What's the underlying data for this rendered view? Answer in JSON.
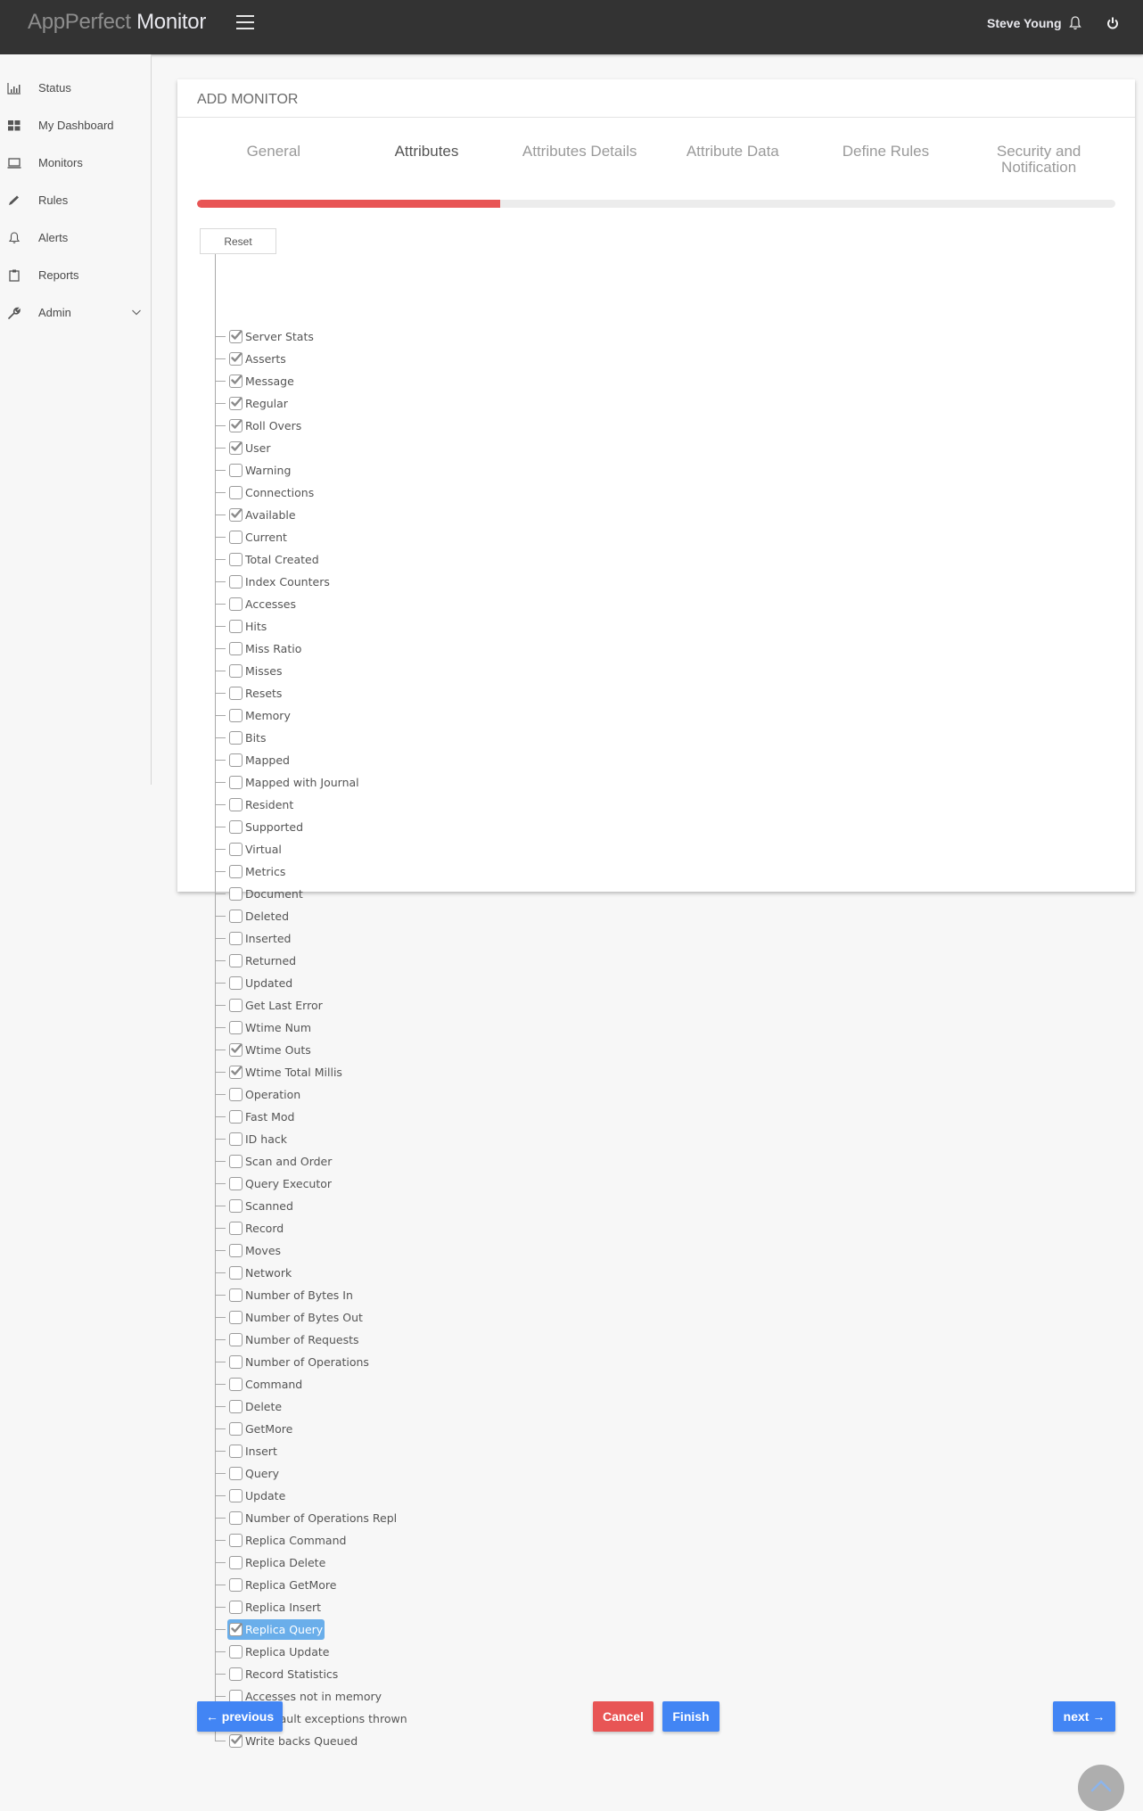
{
  "header": {
    "brand_light": "AppPerfect ",
    "brand_strong": "Monitor",
    "user_name": "Steve Young",
    "icons": {
      "menu": "hamburger-icon",
      "notifications": "bell-icon",
      "logout": "power-icon"
    }
  },
  "sidebar": {
    "items": [
      {
        "label": "Status",
        "icon": "bar-chart-icon"
      },
      {
        "label": "My Dashboard",
        "icon": "dashboard-grid-icon"
      },
      {
        "label": "Monitors",
        "icon": "laptop-icon"
      },
      {
        "label": "Rules",
        "icon": "pencil-icon"
      },
      {
        "label": "Alerts",
        "icon": "bell-icon"
      },
      {
        "label": "Reports",
        "icon": "clipboard-icon"
      },
      {
        "label": "Admin",
        "icon": "wrench-icon",
        "expandable": true
      }
    ]
  },
  "card": {
    "title": "ADD MONITOR",
    "wizard": {
      "tabs": [
        {
          "label": "General",
          "active": false
        },
        {
          "label": "Attributes",
          "active": true
        },
        {
          "label": "Attributes Details",
          "active": false
        },
        {
          "label": "Attribute Data",
          "active": false
        },
        {
          "label": "Define Rules",
          "active": false
        },
        {
          "label": "Security and Notification",
          "active": false
        }
      ],
      "progress_percent": 33,
      "progress_color": "#e85555"
    },
    "reset_label": "Reset",
    "attributes": [
      {
        "label": "Server Stats",
        "checked": true
      },
      {
        "label": "Asserts",
        "checked": true
      },
      {
        "label": "Message",
        "checked": true
      },
      {
        "label": "Regular",
        "checked": true
      },
      {
        "label": "Roll Overs",
        "checked": true
      },
      {
        "label": "User",
        "checked": true
      },
      {
        "label": "Warning",
        "checked": false
      },
      {
        "label": "Connections",
        "checked": false
      },
      {
        "label": "Available",
        "checked": true
      },
      {
        "label": "Current",
        "checked": false
      },
      {
        "label": "Total Created",
        "checked": false
      },
      {
        "label": "Index Counters",
        "checked": false
      },
      {
        "label": "Accesses",
        "checked": false
      },
      {
        "label": "Hits",
        "checked": false
      },
      {
        "label": "Miss Ratio",
        "checked": false
      },
      {
        "label": "Misses",
        "checked": false
      },
      {
        "label": "Resets",
        "checked": false
      },
      {
        "label": "Memory",
        "checked": false
      },
      {
        "label": "Bits",
        "checked": false
      },
      {
        "label": "Mapped",
        "checked": false
      },
      {
        "label": "Mapped with Journal",
        "checked": false
      },
      {
        "label": "Resident",
        "checked": false
      },
      {
        "label": "Supported",
        "checked": false
      },
      {
        "label": "Virtual",
        "checked": false
      },
      {
        "label": "Metrics",
        "checked": false
      },
      {
        "label": "Document",
        "checked": false
      },
      {
        "label": "Deleted",
        "checked": false
      },
      {
        "label": "Inserted",
        "checked": false
      },
      {
        "label": "Returned",
        "checked": false
      },
      {
        "label": "Updated",
        "checked": false
      },
      {
        "label": "Get Last Error",
        "checked": false
      },
      {
        "label": "Wtime Num",
        "checked": false
      },
      {
        "label": "Wtime Outs",
        "checked": true
      },
      {
        "label": "Wtime Total Millis",
        "checked": true
      },
      {
        "label": "Operation",
        "checked": false
      },
      {
        "label": "Fast Mod",
        "checked": false
      },
      {
        "label": "ID hack",
        "checked": false
      },
      {
        "label": "Scan and Order",
        "checked": false
      },
      {
        "label": "Query Executor",
        "checked": false
      },
      {
        "label": "Scanned",
        "checked": false
      },
      {
        "label": "Record",
        "checked": false
      },
      {
        "label": "Moves",
        "checked": false
      },
      {
        "label": "Network",
        "checked": false
      },
      {
        "label": "Number of Bytes In",
        "checked": false
      },
      {
        "label": "Number of Bytes Out",
        "checked": false
      },
      {
        "label": "Number of Requests",
        "checked": false
      },
      {
        "label": "Number of Operations",
        "checked": false
      },
      {
        "label": "Command",
        "checked": false
      },
      {
        "label": "Delete",
        "checked": false
      },
      {
        "label": "GetMore",
        "checked": false
      },
      {
        "label": "Insert",
        "checked": false
      },
      {
        "label": "Query",
        "checked": false
      },
      {
        "label": "Update",
        "checked": false
      },
      {
        "label": "Number of Operations Repl",
        "checked": false
      },
      {
        "label": "Replica Command",
        "checked": false
      },
      {
        "label": "Replica Delete",
        "checked": false
      },
      {
        "label": "Replica GetMore",
        "checked": false
      },
      {
        "label": "Replica Insert",
        "checked": false
      },
      {
        "label": "Replica Query",
        "checked": true,
        "selected": true
      },
      {
        "label": "Replica Update",
        "checked": false
      },
      {
        "label": "Record Statistics",
        "checked": false
      },
      {
        "label": "Accesses not in memory",
        "checked": false
      },
      {
        "label": "Page fault exceptions thrown",
        "checked": true
      },
      {
        "label": "Write backs Queued",
        "checked": true
      }
    ],
    "buttons": {
      "previous": "← previous",
      "cancel": "Cancel",
      "finish": "Finish",
      "next": "next →"
    }
  },
  "colors": {
    "header_bg": "#333333",
    "primary": "#4285f4",
    "danger": "#e85555",
    "selection": "#6aaeea"
  },
  "scroll_top": {
    "icon": "chevron-up-icon"
  }
}
